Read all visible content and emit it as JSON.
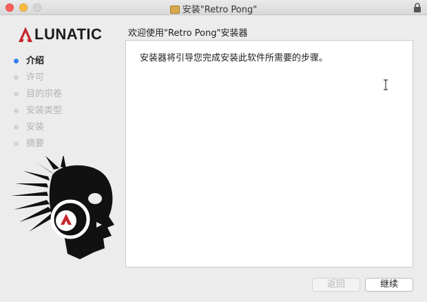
{
  "window": {
    "title": "安装\"Retro Pong\""
  },
  "brand": {
    "name": "LUNATIC",
    "accent": "#c6262e"
  },
  "sidebar": {
    "steps": [
      {
        "label": "介绍",
        "active": true
      },
      {
        "label": "许可",
        "active": false
      },
      {
        "label": "目的宗卷",
        "active": false
      },
      {
        "label": "安装类型",
        "active": false
      },
      {
        "label": "安装",
        "active": false
      },
      {
        "label": "摘要",
        "active": false
      }
    ]
  },
  "main": {
    "heading": "欢迎使用\"Retro Pong\"安装器",
    "body": "安装器将引导您完成安装此软件所需要的步骤。"
  },
  "buttons": {
    "back": "返回",
    "continue": "继续"
  },
  "icons": {
    "package": "package-icon",
    "lock": "lock-icon",
    "logo": "lunatic-logo-icon",
    "cursor": "text-cursor-icon"
  },
  "colors": {
    "active_step": "#2f80ed",
    "close": "#fc605b",
    "minimize": "#fdbc40"
  }
}
